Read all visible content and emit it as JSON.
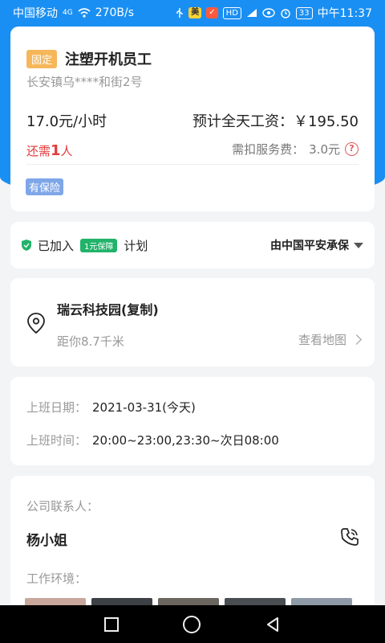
{
  "status_bar": {
    "carrier": "中国移动",
    "network": "4G",
    "speed": "270B/s",
    "badge_1": "美",
    "badge_2": "✓",
    "hd": "HD",
    "battery": "33",
    "time": "中午11:37"
  },
  "job": {
    "tag": "固定",
    "title": "注塑开机员工",
    "address": "长安镇乌****和街2号",
    "wage": "17.0元/小时",
    "estimate_label": "预计全天工资：",
    "estimate_value": "￥195.50",
    "need_prefix": "还需",
    "need_count": "1",
    "need_suffix": "人",
    "fee_label": "需扣服务费：",
    "fee_value": "3.0元",
    "insurance_tag": "有保险"
  },
  "insurance_plan": {
    "joined": "已加入",
    "badge": "1元保障",
    "plan": "计划",
    "provider": "由中国平安承保"
  },
  "location": {
    "name": "瑞云科技园(复制)",
    "distance": "距你8.7千米",
    "map_link": "查看地图"
  },
  "schedule": {
    "date_label": "上班日期：",
    "date_value": "2021-03-31(今天)",
    "time_label": "上班时间：",
    "time_value": "20:00~23:00,23:30~次日08:00"
  },
  "contact": {
    "label": "公司联系人：",
    "name": "杨小姐",
    "env_label": "工作环境："
  },
  "colors": {
    "brand_blue": "#1a8ff3",
    "accent_red": "#e23b3b",
    "tag_orange": "#f6b75a",
    "guard_green": "#21b36a"
  }
}
